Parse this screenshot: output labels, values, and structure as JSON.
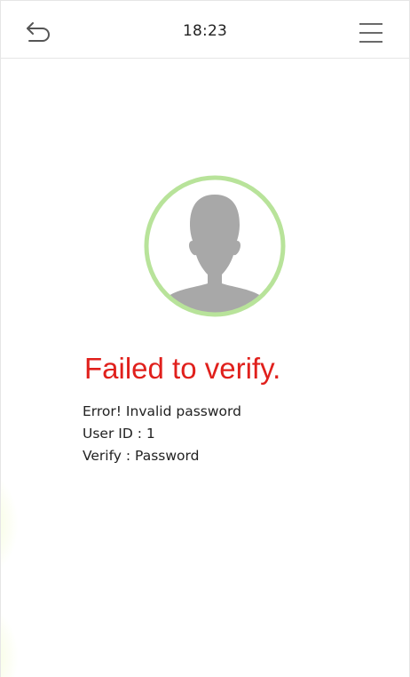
{
  "header": {
    "time": "18:23",
    "back_icon": "back-arrow-icon",
    "menu_icon": "hamburger-menu-icon"
  },
  "avatar": {
    "icon": "user-silhouette-icon",
    "ring_color": "#b8e39a"
  },
  "result": {
    "title": "Failed to verify.",
    "title_color": "#e0201c",
    "lines": [
      "Error! Invalid password",
      "User ID : 1",
      "Verify : Password"
    ]
  }
}
